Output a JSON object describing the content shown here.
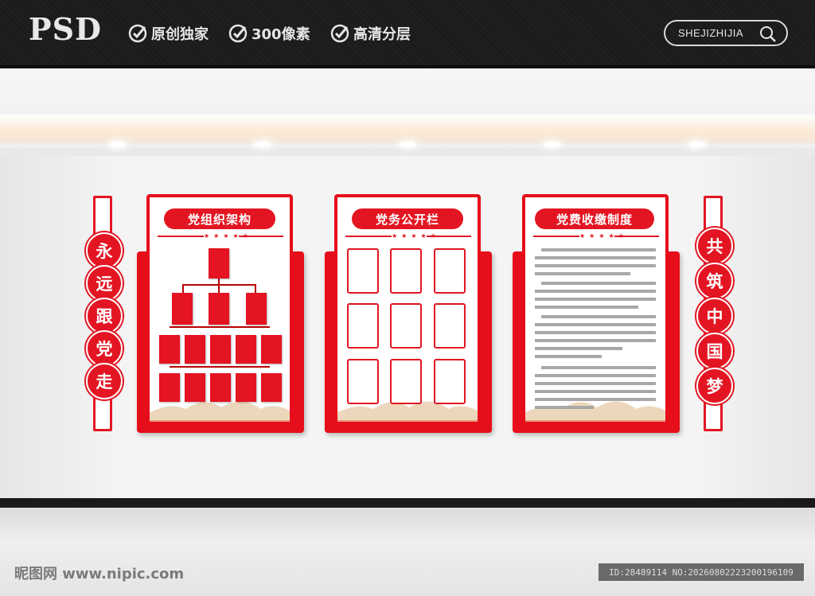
{
  "header": {
    "logo": "PSD",
    "features": [
      "原创独家",
      "300像素",
      "高清分层"
    ],
    "search_label": "SHEJIZHIJIA",
    "icons": {
      "feature": "check-circle-icon",
      "search": "search-icon"
    }
  },
  "left_pillar": {
    "chars": [
      "永",
      "远",
      "跟",
      "党",
      "走"
    ]
  },
  "right_pillar": {
    "chars": [
      "共",
      "筑",
      "中",
      "国",
      "梦"
    ]
  },
  "panels": [
    {
      "title": "党组织架构",
      "stars": "★★★★★"
    },
    {
      "title": "党务公开栏",
      "stars": "★★★★★"
    },
    {
      "title": "党费收缴制度",
      "stars": "★★★★★"
    }
  ],
  "footer": {
    "watermark": "昵图网 www.nipic.com",
    "id_text": "ID:28489114 NO:20260802223200196109"
  },
  "colors": {
    "accent": "#e31522",
    "topbar": "#1b1b1b"
  }
}
